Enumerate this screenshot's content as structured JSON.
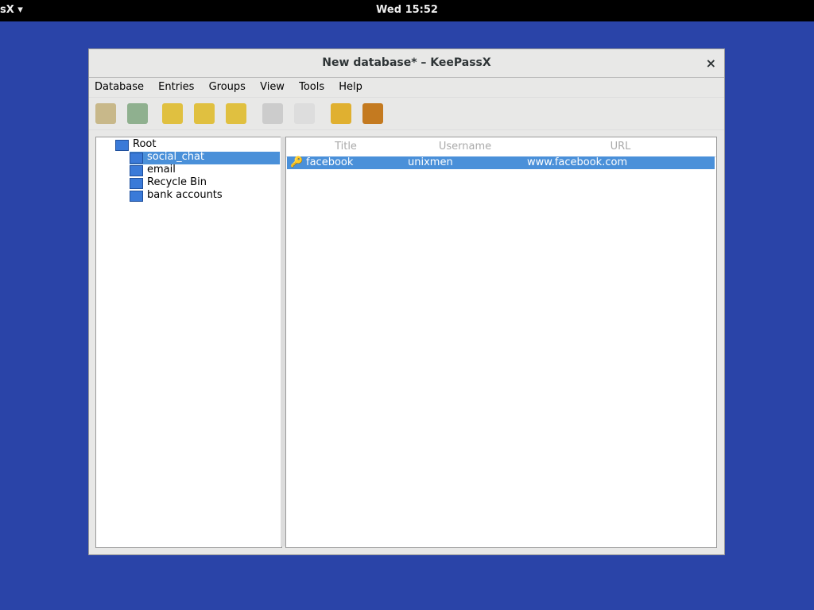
{
  "topbar": {
    "app_label": "sX ▾",
    "clock": "Wed 15:52"
  },
  "window": {
    "title": "New database* – KeePassX",
    "close_label": "×"
  },
  "menu": [
    "Database",
    "Entries",
    "Groups",
    "View",
    "Tools",
    "Help"
  ],
  "tree": {
    "root": "Root",
    "groups": [
      "social_chat",
      "email",
      "Recycle Bin",
      "bank accounts"
    ]
  },
  "table": {
    "headers": [
      "Title",
      "Username",
      "URL"
    ],
    "rows": [
      [
        "facebook",
        "unixmen",
        "www.facebook.com"
      ]
    ]
  },
  "icons": [
    "open-database-icon",
    "save-database-icon",
    "add-entry-icon",
    "edit-entry-icon",
    "delete-entry-icon",
    "copy-username-icon",
    "copy-password-icon",
    "lock-icon",
    "search-icon"
  ]
}
